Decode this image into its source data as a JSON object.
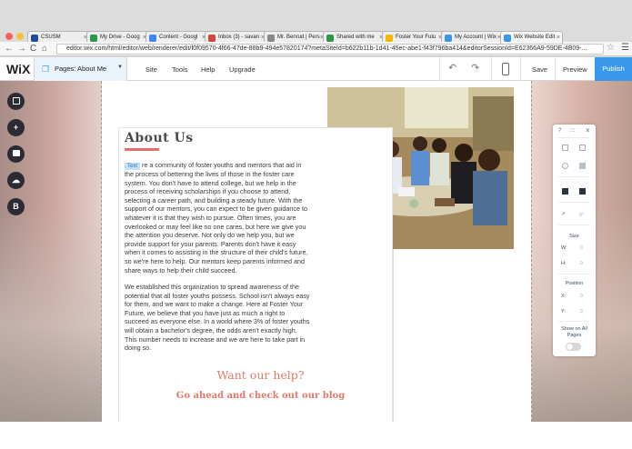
{
  "browser": {
    "tabs": [
      {
        "label": "CSUSM",
        "color": "#1f4e99"
      },
      {
        "label": "My Drive - Goog",
        "color": "#2a9a4a"
      },
      {
        "label": "Content - Googl",
        "color": "#4285f4"
      },
      {
        "label": "Inbox (3) - savan",
        "color": "#d44638"
      },
      {
        "label": "Mr. Benrud | Pers",
        "color": "#888888"
      },
      {
        "label": "Shared with me",
        "color": "#2a9a4a"
      },
      {
        "label": "Foster Your Futu",
        "color": "#f5b400"
      },
      {
        "label": "My Account | Wix",
        "color": "#3899ec"
      },
      {
        "label": "Wix Website Edit",
        "color": "#3899ec"
      }
    ],
    "url": "editor.wix.com/html/editor/web/renderer/edit/f0f09570-4f66-47de-88b9-494e57820174?metaSiteId=b622b11b-1d41-45ec-abe1-f43f796ba414&editorSessionId=E62366A9-59DE-4B09-..."
  },
  "wix": {
    "logo": "WiX",
    "page_selector": "Pages: About Me",
    "menu": [
      "Site",
      "Tools",
      "Help",
      "Upgrade"
    ],
    "save": "Save",
    "preview": "Preview",
    "publish": "Publish"
  },
  "left_tools": [
    "add-elements",
    "add",
    "background",
    "upload",
    "blog"
  ],
  "content": {
    "heading": "About Us",
    "edit_tag": "Text",
    "paragraph1": "re a community of foster youths and mentors that aid in the process of bettering the lives of those in the foster care system. You don't have to attend college, but we help in the process of receiving scholarships if you choose to attend, selecting a career path, and building a steady future. With the support of our mentors, you can expect to be given guidance to whatever it is that they wish to pursue. Often times, you are overlooked or may feel like no one cares, but here we give you the attention you deserve. Not only do we help you, but we provide support for your parents. Parents don't have it easy when it comes to assisting in the structure of their child's future, so we're here to help. Our mentors keep parents informed and share ways to help their child succeed.",
    "paragraph2": "We established this organization to spread awareness of the potential that all foster youths possess. School isn't always easy for them, and we want to make a change. Here at Foster Your Future, we believe that you have just as much a right to succeed as everyone else. In a world where 3% of foster youths will obtain a bachelor's degree, the odds aren't exactly high. This number needs to increase and we are here to take part in doing so.",
    "cta_title": "Want our help?",
    "cta_link": "Go ahead and check out our blog"
  },
  "panel": {
    "help": "?",
    "drag": "::::",
    "close": "×",
    "size_label": "Size",
    "w_label": "W:",
    "w_value": "0",
    "h_label": "H:",
    "h_value": "0",
    "position_label": "Position",
    "x_label": "X:",
    "x_value": "0",
    "y_label": "Y:",
    "y_value": "0",
    "show_all_pages": "Show on All Pages",
    "angle_value": "0°"
  },
  "colors": {
    "accent": "#3899ec",
    "heading_underline": "#e0706a",
    "cta": "#e07a6b"
  }
}
